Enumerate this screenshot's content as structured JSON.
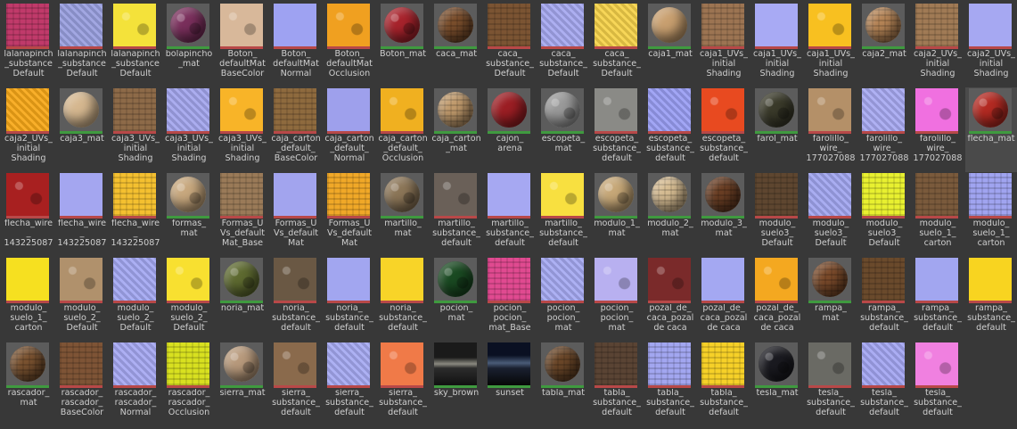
{
  "items": [
    {
      "label": "lalanapinch\n_substance\nDefault",
      "color": "#c03a6a",
      "kind": "flat",
      "tex": "tex2",
      "bar": "#b84848"
    },
    {
      "label": "lalanapinch\n_substance\nDefault",
      "color": "#9aa0e0",
      "kind": "flat",
      "tex": "tex1",
      "bar": "#b84848"
    },
    {
      "label": "lalanapinch\n_substance\nDefault",
      "color": "#f4e23a",
      "kind": "flat",
      "tex": "tex3",
      "bar": "#b84848"
    },
    {
      "label": "bolapincho\n_mat",
      "color": "#7a2f5c",
      "kind": "ball",
      "tex": "tex3",
      "bar": "#3f9a3f"
    },
    {
      "label": "Boton_\ndefaultMat\nBaseColor",
      "color": "#d8b89a",
      "kind": "flat",
      "tex": "tex3",
      "bar": "#b84848"
    },
    {
      "label": "Boton_\ndefaultMat\nNormal",
      "color": "#9ea2f2",
      "kind": "flat",
      "tex": "",
      "bar": "#b84848"
    },
    {
      "label": "Boton_\ndefaultMat\nOcclusion",
      "color": "#f0a020",
      "kind": "flat",
      "tex": "tex3",
      "bar": "#b84848"
    },
    {
      "label": "Boton_mat",
      "color": "#a8232c",
      "kind": "ball",
      "tex": "tex3",
      "bar": "#3f9a3f"
    },
    {
      "label": "caca_mat",
      "color": "#7a4e2c",
      "kind": "ball",
      "tex": "tex2",
      "bar": "#3f9a3f"
    },
    {
      "label": "caca_\nsubstance_\nDefault",
      "color": "#7b5433",
      "kind": "flat",
      "tex": "tex2",
      "bar": "#b84848"
    },
    {
      "label": "caca_\nsubstance_\nDefault",
      "color": "#a6a8f0",
      "kind": "flat",
      "tex": "tex1",
      "bar": "#b84848"
    },
    {
      "label": "caca_\nsubstance_\nDefault",
      "color": "#f6d24a",
      "kind": "flat",
      "tex": "tex1",
      "bar": "#b84848"
    },
    {
      "label": "caja1_mat",
      "color": "#c9a070",
      "kind": "ball",
      "tex": "",
      "bar": "#3f9a3f"
    },
    {
      "label": "caja1_UVs_\ninitial\nShading",
      "color": "#9c7452",
      "kind": "flat",
      "tex": "tex2",
      "bar": "#b84848"
    },
    {
      "label": "caja1_UVs_\ninitial\nShading",
      "color": "#a8aaf4",
      "kind": "flat",
      "tex": "",
      "bar": "#b84848"
    },
    {
      "label": "caja1_UVs_\ninitial\nShading",
      "color": "#f8c020",
      "kind": "flat",
      "tex": "tex3",
      "bar": "#b84848"
    },
    {
      "label": "caja2_mat",
      "color": "#b58456",
      "kind": "ball",
      "tex": "tex2",
      "bar": "#3f9a3f"
    },
    {
      "label": "caja2_UVs_\ninitial\nShading",
      "color": "#a07a55",
      "kind": "flat",
      "tex": "tex2",
      "bar": "#b84848"
    },
    {
      "label": "caja2_UVs_\ninitial\nShading",
      "color": "#a6a8f2",
      "kind": "flat",
      "tex": "",
      "bar": "#b84848"
    },
    {
      "label": "caja2_UVs_\ninitial\nShading",
      "color": "#f8a818",
      "kind": "flat",
      "tex": "tex1",
      "bar": "#b84848"
    },
    {
      "label": "caja3_mat",
      "color": "#d6b890",
      "kind": "ball",
      "tex": "",
      "bar": "#3f9a3f"
    },
    {
      "label": "caja3_UVs_\ninitial\nShading",
      "color": "#8d6a48",
      "kind": "flat",
      "tex": "tex2",
      "bar": "#b84848"
    },
    {
      "label": "caja3_UVs_\ninitial\nShading",
      "color": "#a4a6ee",
      "kind": "flat",
      "tex": "tex1",
      "bar": "#b84848"
    },
    {
      "label": "caja3_UVs_\ninitial\nShading",
      "color": "#f8b428",
      "kind": "flat",
      "tex": "tex3",
      "bar": "#b84848"
    },
    {
      "label": "caja_carton\n_default_\nBaseColor",
      "color": "#8e6a3e",
      "kind": "flat",
      "tex": "tex2",
      "bar": "#b84848"
    },
    {
      "label": "caja_carton\n_default_\nNormal",
      "color": "#9ea0ec",
      "kind": "flat",
      "tex": "",
      "bar": "#b84848"
    },
    {
      "label": "caja_carton\n_default_\nOcclusion",
      "color": "#f0b020",
      "kind": "flat",
      "tex": "tex3",
      "bar": "#b84848"
    },
    {
      "label": "caja_carton\n_mat",
      "color": "#c09a6c",
      "kind": "ball",
      "tex": "tex2",
      "bar": "#3f9a3f"
    },
    {
      "label": "cajon_\narena",
      "color": "#9c1e24",
      "kind": "ball",
      "tex": "",
      "bar": "#3f9a3f"
    },
    {
      "label": "escopeta_\nmat",
      "color": "#9a9a9a",
      "kind": "ball",
      "tex": "tex3",
      "bar": "#3f9a3f"
    },
    {
      "label": "escopeta_\nsubstance_\ndefault",
      "color": "#8a8a86",
      "kind": "flat",
      "tex": "tex3",
      "bar": "#b84848"
    },
    {
      "label": "escopeta_\nsubstance_\ndefault",
      "color": "#9a9ef4",
      "kind": "flat",
      "tex": "tex1",
      "bar": "#b84848"
    },
    {
      "label": "escopeta_\nsubstance_\ndefault",
      "color": "#e84a20",
      "kind": "flat",
      "tex": "tex3",
      "bar": "#b84848"
    },
    {
      "label": "farol_mat",
      "color": "#3a3a2a",
      "kind": "ball",
      "tex": "tex3",
      "bar": "#3f9a3f"
    },
    {
      "label": "farolillo_\nwire_\n177027088",
      "color": "#b49068",
      "kind": "flat",
      "tex": "tex3",
      "bar": "#b84848"
    },
    {
      "label": "farolillo_\nwire_\n177027088",
      "color": "#a8aaf2",
      "kind": "flat",
      "tex": "tex1",
      "bar": "#b84848"
    },
    {
      "label": "farolillo_\nwire_\n177027088",
      "color": "#f070e0",
      "kind": "flat",
      "tex": "tex3",
      "bar": "#b84848"
    },
    {
      "label": "flecha_mat",
      "color": "#b42a22",
      "kind": "ball",
      "tex": "tex3",
      "bar": "#3f9a3f",
      "selected": true
    },
    {
      "label": "flecha_wire\n_\n143225087",
      "color": "#a82020",
      "kind": "flat",
      "tex": "tex3",
      "bar": "#b84848"
    },
    {
      "label": "flecha_wire\n_\n143225087",
      "color": "#a4a6f0",
      "kind": "flat",
      "tex": "",
      "bar": "#b84848"
    },
    {
      "label": "flecha_wire\n_\n143225087",
      "color": "#f4c030",
      "kind": "flat",
      "tex": "tex2",
      "bar": "#b84848"
    },
    {
      "label": "formas_\nmat",
      "color": "#c8a87e",
      "kind": "ball",
      "tex": "tex3",
      "bar": "#3f9a3f"
    },
    {
      "label": "Formas_U\nVs_default\nMat_Base",
      "color": "#9a7a58",
      "kind": "flat",
      "tex": "tex2",
      "bar": "#b84848"
    },
    {
      "label": "Formas_U\nVs_default\nMat",
      "color": "#a2a4ee",
      "kind": "flat",
      "tex": "",
      "bar": "#b84848"
    },
    {
      "label": "Formas_U\nVs_default\nMat",
      "color": "#f0a828",
      "kind": "flat",
      "tex": "tex2",
      "bar": "#b84848"
    },
    {
      "label": "martillo_\nmat",
      "color": "#8c7658",
      "kind": "ball",
      "tex": "tex3",
      "bar": "#3f9a3f"
    },
    {
      "label": "martillo_\nsubstance_\ndefault",
      "color": "#6a6058",
      "kind": "flat",
      "tex": "tex3",
      "bar": "#b84848"
    },
    {
      "label": "martillo_\nsubstance_\ndefault",
      "color": "#a6a8f2",
      "kind": "flat",
      "tex": "",
      "bar": "#b84848"
    },
    {
      "label": "martillo_\nsubstance_\ndefault",
      "color": "#f8e040",
      "kind": "flat",
      "tex": "tex3",
      "bar": "#b84848"
    },
    {
      "label": "modulo_1_\nmat",
      "color": "#c7a878",
      "kind": "ball",
      "tex": "tex3",
      "bar": "#3f9a3f"
    },
    {
      "label": "modulo_2_\nmat",
      "color": "#d6bc92",
      "kind": "ball",
      "tex": "tex2",
      "bar": "#3f9a3f"
    },
    {
      "label": "modulo_3_\nmat",
      "color": "#6a3e24",
      "kind": "ball",
      "tex": "tex2",
      "bar": "#3f9a3f"
    },
    {
      "label": "modulo_\nsuelo3_\nDefault",
      "color": "#5e4630",
      "kind": "flat",
      "tex": "tex2",
      "bar": "#b84848"
    },
    {
      "label": "modulo_\nsuelo3_\nDefault",
      "color": "#a2a6f0",
      "kind": "flat",
      "tex": "tex1",
      "bar": "#b84848"
    },
    {
      "label": "modulo_\nsuelo3_\nDefault",
      "color": "#e8f030",
      "kind": "flat",
      "tex": "tex2",
      "bar": "#b84848"
    },
    {
      "label": "modulo_\nsuelo_1_\ncarton",
      "color": "#7a5a3c",
      "kind": "flat",
      "tex": "tex2",
      "bar": "#b84848"
    },
    {
      "label": "modulo_\nsuelo_1_\ncarton",
      "color": "#a0a4f0",
      "kind": "flat",
      "tex": "tex2",
      "bar": "#b84848"
    },
    {
      "label": "modulo_\nsuelo_1_\ncarton",
      "color": "#f6e020",
      "kind": "flat",
      "tex": "",
      "bar": "#b84848"
    },
    {
      "label": "modulo_\nsuelo_2_\nDefault",
      "color": "#b0916c",
      "kind": "flat",
      "tex": "tex3",
      "bar": "#b84848"
    },
    {
      "label": "modulo_\nsuelo_2_\nDefault",
      "color": "#a4a8f2",
      "kind": "flat",
      "tex": "tex1",
      "bar": "#b84848"
    },
    {
      "label": "modulo_\nsuelo_2_\nDefault",
      "color": "#f8e030",
      "kind": "flat",
      "tex": "tex3",
      "bar": "#b84848"
    },
    {
      "label": "noria_mat",
      "color": "#5e6a30",
      "kind": "ball",
      "tex": "tex3",
      "bar": "#3f9a3f"
    },
    {
      "label": "noria_\nsubstance_\ndefault",
      "color": "#6a5844",
      "kind": "flat",
      "tex": "tex3",
      "bar": "#b84848"
    },
    {
      "label": "noria_\nsubstance_\ndefault",
      "color": "#a2a6f0",
      "kind": "flat",
      "tex": "",
      "bar": "#b84848"
    },
    {
      "label": "noria_\nsubstance_\ndefault",
      "color": "#f8d428",
      "kind": "flat",
      "tex": "",
      "bar": "#b84848"
    },
    {
      "label": "pocion_\nmat",
      "color": "#1a4a22",
      "kind": "ball",
      "tex": "tex3",
      "bar": "#3f9a3f"
    },
    {
      "label": "pocion_\npocion_\nmat_Base",
      "color": "#e04a90",
      "kind": "flat",
      "tex": "tex2",
      "bar": "#b84848"
    },
    {
      "label": "pocion_\npocion_\nmat",
      "color": "#a6aaf2",
      "kind": "flat",
      "tex": "tex1",
      "bar": "#b84848"
    },
    {
      "label": "pocion_\npocion_\nmat",
      "color": "#b8b0f0",
      "kind": "flat",
      "tex": "tex3",
      "bar": "#b84848"
    },
    {
      "label": "pozal_de_\ncaca_pozal\nde caca",
      "color": "#7a2a2a",
      "kind": "flat",
      "tex": "tex3",
      "bar": "#b84848"
    },
    {
      "label": "pozal_de_\ncaca_pozal\nde caca",
      "color": "#a4a8f2",
      "kind": "flat",
      "tex": "",
      "bar": "#b84848"
    },
    {
      "label": "pozal_de_\ncaca_pozal\nde caca",
      "color": "#f4a820",
      "kind": "flat",
      "tex": "tex3",
      "bar": "#b84848"
    },
    {
      "label": "rampa_\nmat",
      "color": "#7a4a2a",
      "kind": "ball",
      "tex": "tex2",
      "bar": "#3f9a3f"
    },
    {
      "label": "rampa_\nsubstance_\ndefault",
      "color": "#6a4a2c",
      "kind": "flat",
      "tex": "tex2",
      "bar": "#b84848"
    },
    {
      "label": "rampa_\nsubstance_\ndefault",
      "color": "#a2a6f0",
      "kind": "flat",
      "tex": "",
      "bar": "#b84848"
    },
    {
      "label": "rampa_\nsubstance_\ndefault",
      "color": "#f8d420",
      "kind": "flat",
      "tex": "",
      "bar": "#b84848"
    },
    {
      "label": "rascador_\nmat",
      "color": "#7a5230",
      "kind": "ball",
      "tex": "tex2",
      "bar": "#3f9a3f"
    },
    {
      "label": "rascador_\nrascador_\nBaseColor",
      "color": "#7e5436",
      "kind": "flat",
      "tex": "tex2",
      "bar": "#b84848"
    },
    {
      "label": "rascador_\nrascador_\nNormal",
      "color": "#a6a8f2",
      "kind": "flat",
      "tex": "tex1",
      "bar": "#b84848"
    },
    {
      "label": "rascador_\nrascador_\nOcclusion",
      "color": "#d8e020",
      "kind": "flat",
      "tex": "tex2",
      "bar": "#b84848"
    },
    {
      "label": "sierra_mat",
      "color": "#b89a7c",
      "kind": "ball",
      "tex": "tex3",
      "bar": "#3f9a3f"
    },
    {
      "label": "sierra_\nsubstance_\ndefault",
      "color": "#8a6a4c",
      "kind": "flat",
      "tex": "tex3",
      "bar": "#b84848"
    },
    {
      "label": "sierra_\nsubstance_\ndefault",
      "color": "#a6aaf2",
      "kind": "flat",
      "tex": "tex1",
      "bar": "#b84848"
    },
    {
      "label": "sierra_\nsubstance_\ndefault",
      "color": "#f07a48",
      "kind": "flat",
      "tex": "tex3",
      "bar": "#b84848"
    },
    {
      "label": "sky_brown",
      "color": "#404040",
      "kind": "sky",
      "tex": "",
      "bar": "#3f9a3f"
    },
    {
      "label": "sunset",
      "color": "#202838",
      "kind": "sunset",
      "tex": "",
      "bar": "#3f9a3f"
    },
    {
      "label": "tabla_mat",
      "color": "#6a4628",
      "kind": "ball",
      "tex": "tex2",
      "bar": "#3f9a3f"
    },
    {
      "label": "tabla_\nsubstance_\ndefault",
      "color": "#5a4434",
      "kind": "flat",
      "tex": "tex2",
      "bar": "#b84848"
    },
    {
      "label": "tabla_\nsubstance_\ndefault",
      "color": "#a2a6f0",
      "kind": "flat",
      "tex": "tex2",
      "bar": "#b84848"
    },
    {
      "label": "tabla_\nsubstance_\ndefault",
      "color": "#f6d028",
      "kind": "flat",
      "tex": "tex2",
      "bar": "#b84848"
    },
    {
      "label": "tesla_mat",
      "color": "#1a1a20",
      "kind": "ball",
      "tex": "tex3",
      "bar": "#3f9a3f"
    },
    {
      "label": "tesla_\nsubstance_\ndefault",
      "color": "#6a6a64",
      "kind": "flat",
      "tex": "tex3",
      "bar": "#b84848"
    },
    {
      "label": "tesla_\nsubstance_\ndefault",
      "color": "#a4a6f2",
      "kind": "flat",
      "tex": "tex1",
      "bar": "#b84848"
    },
    {
      "label": "tesla_\nsubstance_\ndefault",
      "color": "#f080e0",
      "kind": "flat",
      "tex": "tex3",
      "bar": "#b84848"
    }
  ]
}
